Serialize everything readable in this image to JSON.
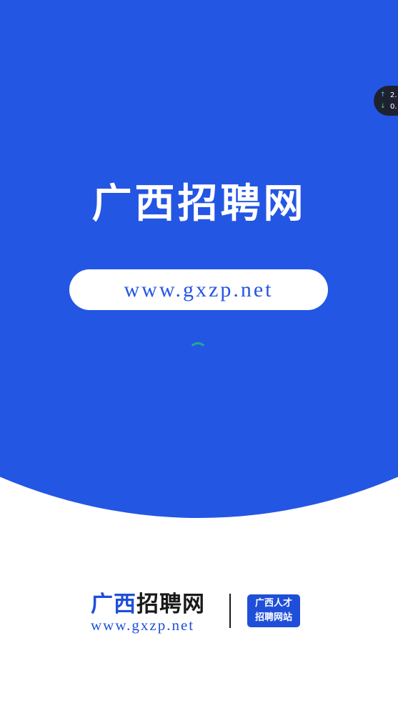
{
  "splash": {
    "title": "广西招聘网",
    "url": "www.gxzp.net"
  },
  "net_speed": {
    "upload": "2.",
    "download": "0."
  },
  "footer": {
    "title_blue": "广西",
    "title_dark": "招聘网",
    "url": "www.gxzp.net",
    "badge_line1": "广西人才",
    "badge_line2": "招聘网站"
  },
  "colors": {
    "brand_blue": "#2456e4",
    "logo_blue": "#1f4fd8",
    "spinner": "#1fae8a"
  },
  "icons": {
    "upload": "arrow-up-icon",
    "download": "arrow-down-icon",
    "loading": "loading-spinner-icon"
  }
}
